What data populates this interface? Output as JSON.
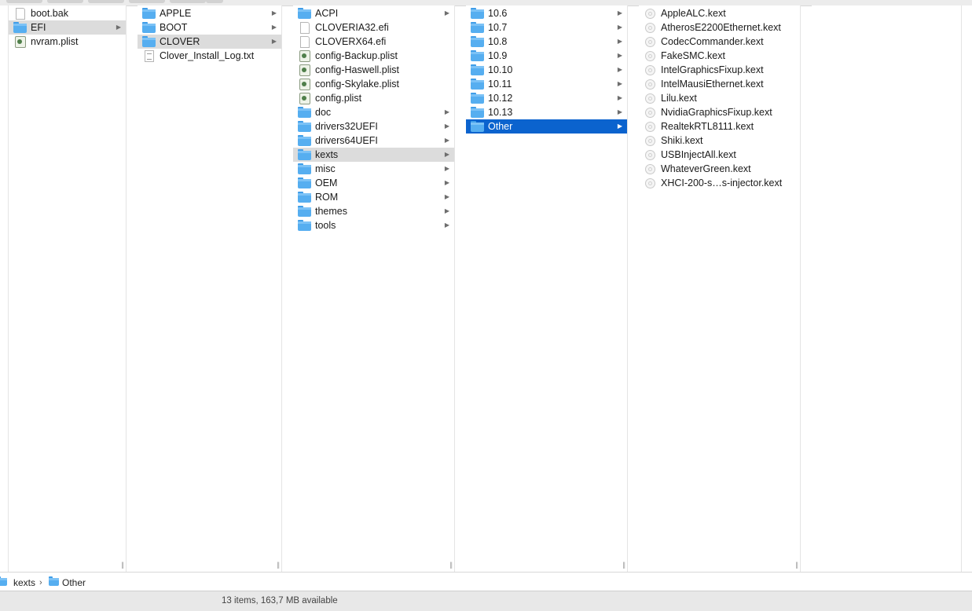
{
  "columns": [
    {
      "items": [
        {
          "name": "boot.bak",
          "icon": "document-icon",
          "folder": false
        },
        {
          "name": "EFI",
          "icon": "folder-icon",
          "folder": true,
          "selected": "gray"
        },
        {
          "name": "nvram.plist",
          "icon": "plist-icon",
          "folder": false
        }
      ]
    },
    {
      "items": [
        {
          "name": "APPLE",
          "icon": "folder-icon",
          "folder": true
        },
        {
          "name": "BOOT",
          "icon": "folder-icon",
          "folder": true
        },
        {
          "name": "CLOVER",
          "icon": "folder-icon",
          "folder": true,
          "selected": "gray"
        },
        {
          "name": "Clover_Install_Log.txt",
          "icon": "text-file-icon",
          "folder": false
        }
      ]
    },
    {
      "items": [
        {
          "name": "ACPI",
          "icon": "folder-icon",
          "folder": true
        },
        {
          "name": "CLOVERIA32.efi",
          "icon": "document-icon",
          "folder": false
        },
        {
          "name": "CLOVERX64.efi",
          "icon": "document-icon",
          "folder": false
        },
        {
          "name": "config-Backup.plist",
          "icon": "plist-icon",
          "folder": false
        },
        {
          "name": "config-Haswell.plist",
          "icon": "plist-icon",
          "folder": false
        },
        {
          "name": "config-Skylake.plist",
          "icon": "plist-icon",
          "folder": false
        },
        {
          "name": "config.plist",
          "icon": "plist-icon",
          "folder": false
        },
        {
          "name": "doc",
          "icon": "folder-icon",
          "folder": true
        },
        {
          "name": "drivers32UEFI",
          "icon": "folder-icon",
          "folder": true
        },
        {
          "name": "drivers64UEFI",
          "icon": "folder-icon",
          "folder": true
        },
        {
          "name": "kexts",
          "icon": "folder-icon",
          "folder": true,
          "selected": "gray"
        },
        {
          "name": "misc",
          "icon": "folder-icon",
          "folder": true
        },
        {
          "name": "OEM",
          "icon": "folder-icon",
          "folder": true
        },
        {
          "name": "ROM",
          "icon": "folder-icon",
          "folder": true
        },
        {
          "name": "themes",
          "icon": "folder-icon",
          "folder": true
        },
        {
          "name": "tools",
          "icon": "folder-icon",
          "folder": true
        }
      ]
    },
    {
      "items": [
        {
          "name": "10.6",
          "icon": "folder-icon",
          "folder": true
        },
        {
          "name": "10.7",
          "icon": "folder-icon",
          "folder": true
        },
        {
          "name": "10.8",
          "icon": "folder-icon",
          "folder": true
        },
        {
          "name": "10.9",
          "icon": "folder-icon",
          "folder": true
        },
        {
          "name": "10.10",
          "icon": "folder-icon",
          "folder": true
        },
        {
          "name": "10.11",
          "icon": "folder-icon",
          "folder": true
        },
        {
          "name": "10.12",
          "icon": "folder-icon",
          "folder": true
        },
        {
          "name": "10.13",
          "icon": "folder-icon",
          "folder": true
        },
        {
          "name": "Other",
          "icon": "folder-icon",
          "folder": true,
          "selected": "blue"
        }
      ]
    },
    {
      "items": [
        {
          "name": "AppleALC.kext",
          "icon": "kext-icon",
          "folder": false
        },
        {
          "name": "AtherosE2200Ethernet.kext",
          "icon": "kext-icon",
          "folder": false
        },
        {
          "name": "CodecCommander.kext",
          "icon": "kext-icon",
          "folder": false
        },
        {
          "name": "FakeSMC.kext",
          "icon": "kext-icon",
          "folder": false
        },
        {
          "name": "IntelGraphicsFixup.kext",
          "icon": "kext-icon",
          "folder": false
        },
        {
          "name": "IntelMausiEthernet.kext",
          "icon": "kext-icon",
          "folder": false
        },
        {
          "name": "Lilu.kext",
          "icon": "kext-icon",
          "folder": false
        },
        {
          "name": "NvidiaGraphicsFixup.kext",
          "icon": "kext-icon",
          "folder": false
        },
        {
          "name": "RealtekRTL8111.kext",
          "icon": "kext-icon",
          "folder": false
        },
        {
          "name": "Shiki.kext",
          "icon": "kext-icon",
          "folder": false
        },
        {
          "name": "USBInjectAll.kext",
          "icon": "kext-icon",
          "folder": false
        },
        {
          "name": "WhateverGreen.kext",
          "icon": "kext-icon",
          "folder": false
        },
        {
          "name": "XHCI-200-s…s-injector.kext",
          "icon": "kext-icon",
          "folder": false
        }
      ]
    },
    {
      "items": []
    }
  ],
  "pathbar": {
    "crumbs": [
      "kexts",
      "Other"
    ],
    "separator": "›"
  },
  "status": {
    "text": "13 items, 163,7 MB available"
  },
  "glyphs": {
    "arrow": "▶",
    "grip": "||"
  },
  "colors": {
    "selection_blue": "#0b63ce",
    "selection_gray": "#dcdcdc",
    "folder_blue": "#56aef0"
  }
}
